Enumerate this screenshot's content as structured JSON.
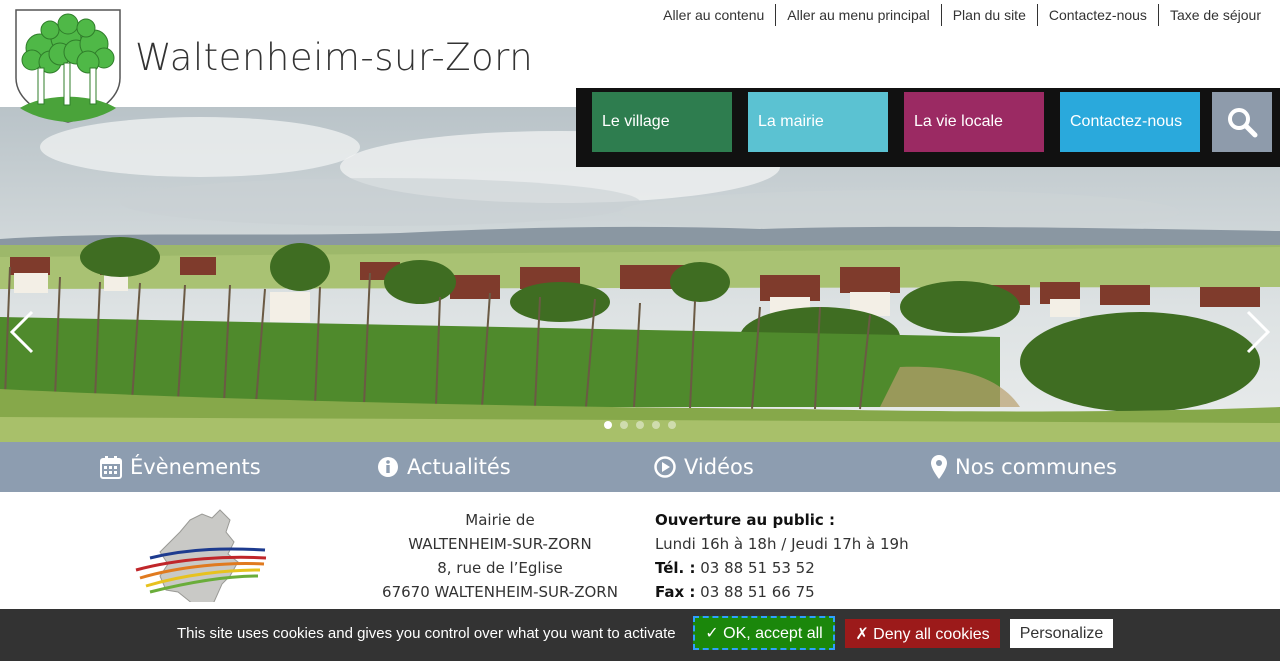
{
  "site": {
    "title": "Waltenheim-sur-Zorn"
  },
  "toplinks": [
    {
      "label": "Aller au contenu"
    },
    {
      "label": "Aller au menu principal"
    },
    {
      "label": "Plan du site"
    },
    {
      "label": "Contactez-nous"
    },
    {
      "label": "Taxe de séjour"
    }
  ],
  "mainnav": [
    {
      "label": "Le village",
      "color": "#2e7d4f"
    },
    {
      "label": "La mairie",
      "color": "#5bc2d2"
    },
    {
      "label": "La vie locale",
      "color": "#9b2a63"
    },
    {
      "label": "Contactez-nous",
      "color": "#2aa9dc"
    }
  ],
  "search": {
    "icon": "search-icon"
  },
  "slider": {
    "slide_count": 5,
    "active_index": 0
  },
  "subnav": [
    {
      "label": "Évènements",
      "icon": "calendar-icon"
    },
    {
      "label": "Actualités",
      "icon": "info-icon"
    },
    {
      "label": "Vidéos",
      "icon": "play-icon"
    },
    {
      "label": "Nos communes",
      "icon": "map-marker-icon"
    }
  ],
  "address": {
    "line1": "Mairie de",
    "line2": "WALTENHEIM-SUR-ZORN",
    "line3": "8, rue de l’Eglise",
    "line4": "67670 WALTENHEIM-SUR-ZORN"
  },
  "hours": {
    "heading": "Ouverture au public :",
    "schedule": "Lundi 16h à 18h / Jeudi 17h à 19h",
    "tel_label": "Tél. :",
    "tel": "03 88 51 53 52",
    "fax_label": "Fax :",
    "fax": "03 88 51 66 75"
  },
  "cookies": {
    "text": "This site uses cookies and gives you control over what you want to activate",
    "accept": "✓ OK, accept all",
    "deny": "✗ Deny all cookies",
    "personalize": "Personalize"
  },
  "colors": {
    "subnav_bg": "#8d9db0",
    "search_bg": "#8e9bab",
    "cookie_bg": "#333333",
    "accept_bg": "#1b870b",
    "deny_bg": "#9c1a1a"
  }
}
